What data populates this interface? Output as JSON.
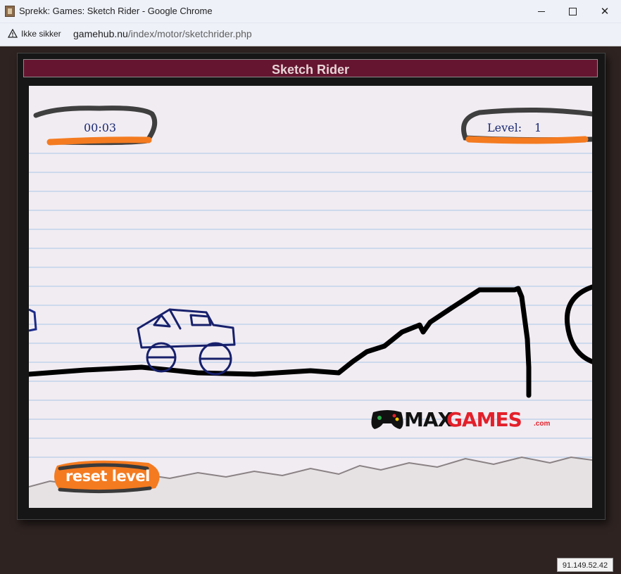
{
  "window": {
    "title": "Sprekk: Games: Sketch Rider - Google Chrome"
  },
  "addressbar": {
    "security_label": "Ikke sikker",
    "url_domain": "gamehub.nu",
    "url_path": "/index/motor/sketchrider.php"
  },
  "game": {
    "title": "Sketch Rider",
    "timer": "00:03",
    "level_label": "Level:",
    "level_value": "1",
    "reset_label": "reset level",
    "logo": {
      "max": "MAX",
      "games": "GAMES",
      "com": ".com"
    }
  },
  "status": {
    "ip": "91.149.52.42"
  },
  "colors": {
    "header_bg": "#651530",
    "paper": "#f1ecf2",
    "ink": "#1a2a74",
    "accent_orange": "#f47b20"
  }
}
